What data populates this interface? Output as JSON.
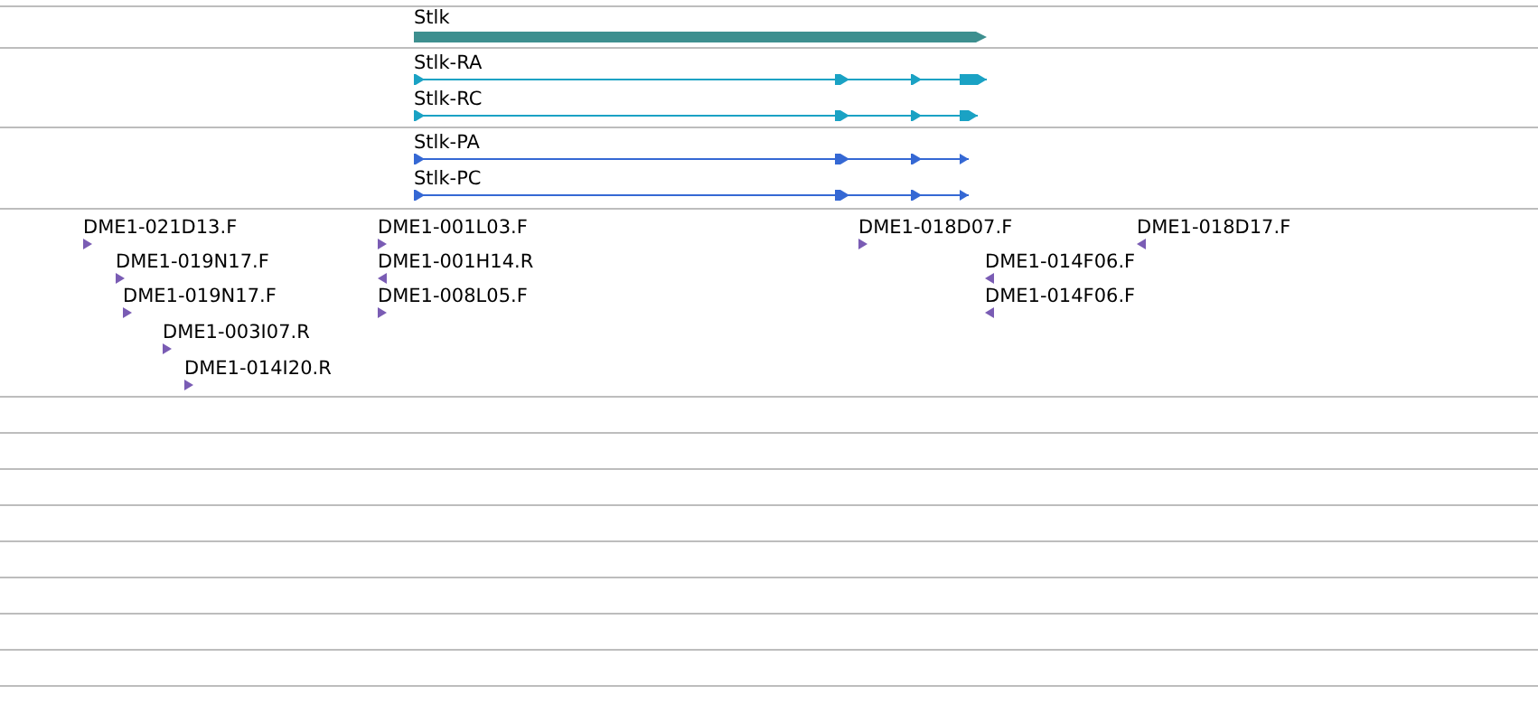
{
  "tracks": [
    {
      "kind": "gene",
      "features": [
        {
          "name": "Stlk",
          "reverse": false
        }
      ]
    },
    {
      "kind": "transcript",
      "features": [
        {
          "name": "Stlk-RA",
          "reverse": false
        },
        {
          "name": "Stlk-RC",
          "reverse": false
        }
      ]
    },
    {
      "kind": "protein",
      "features": [
        {
          "name": "Stlk-PA",
          "reverse": false
        },
        {
          "name": "Stlk-PC",
          "reverse": false
        }
      ]
    },
    {
      "kind": "est",
      "features": [
        {
          "name": "DME1-021D13.F",
          "reverse": false
        },
        {
          "name": "DME1-019N17.F",
          "reverse": false
        },
        {
          "name": "DME1-019N17.F",
          "reverse": false
        },
        {
          "name": "DME1-003I07.R",
          "reverse": false
        },
        {
          "name": "DME1-014I20.R",
          "reverse": false
        },
        {
          "name": "DME1-001L03.F",
          "reverse": false
        },
        {
          "name": "DME1-001H14.R",
          "reverse": true
        },
        {
          "name": "DME1-008L05.F",
          "reverse": false
        },
        {
          "name": "DME1-018D07.F",
          "reverse": false
        },
        {
          "name": "DME1-018D17.F",
          "reverse": true
        },
        {
          "name": "DME1-014F06.F",
          "reverse": true
        },
        {
          "name": "DME1-014F06.F",
          "reverse": true
        }
      ]
    }
  ]
}
